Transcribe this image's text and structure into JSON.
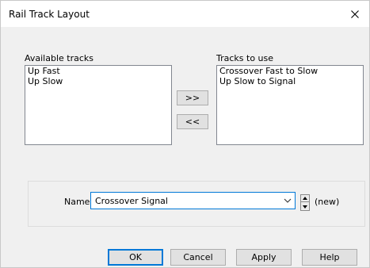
{
  "window": {
    "title": "Rail Track Layout"
  },
  "available": {
    "label": "Available tracks",
    "items": [
      "Up Fast",
      "Up Slow"
    ]
  },
  "selected": {
    "label": "Tracks to use",
    "items": [
      "Crossover Fast to Slow",
      "Up Slow to Signal"
    ]
  },
  "move": {
    "add_label": ">>",
    "remove_label": "<<"
  },
  "name_field": {
    "label": "Name",
    "value": "Crossover Signal",
    "status": "(new)"
  },
  "buttons": {
    "ok": "OK",
    "cancel": "Cancel",
    "apply": "Apply",
    "help": "Help"
  },
  "icons": {
    "close": "close-icon",
    "dropdown": "chevron-down-icon",
    "spin_up": "triangle-up-icon",
    "spin_down": "triangle-down-icon"
  },
  "colors": {
    "focus": "#0078d7",
    "dialog_bg": "#f0f0f0"
  }
}
